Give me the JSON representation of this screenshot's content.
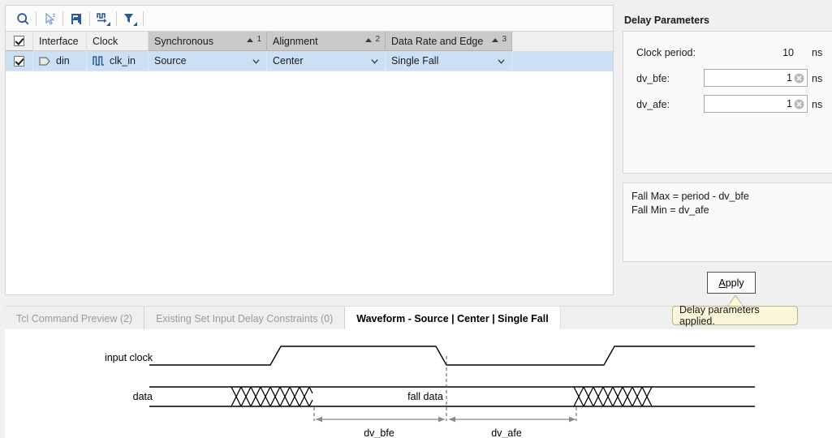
{
  "toolbar": {
    "buttons": [
      {
        "name": "search-icon",
        "label": "Search"
      },
      {
        "name": "select-cursor-icon",
        "label": "Select"
      },
      {
        "name": "auto-detect-icon",
        "label": "Auto Detect"
      },
      {
        "name": "waveform-icon",
        "label": "Waveform Options"
      },
      {
        "name": "filter-icon",
        "label": "Filter"
      }
    ]
  },
  "table": {
    "columns": [
      {
        "label": "",
        "type": "checkbox"
      },
      {
        "label": "Interface",
        "sort": ""
      },
      {
        "label": "Clock",
        "sort": ""
      },
      {
        "label": "Synchronous",
        "sort": "1"
      },
      {
        "label": "Alignment",
        "sort": "2"
      },
      {
        "label": "Data Rate and Edge",
        "sort": "3"
      }
    ],
    "rows": [
      {
        "checked": true,
        "interface": "din",
        "clock": "clk_in",
        "synchronous": "Source",
        "alignment": "Center",
        "data_rate_and_edge": "Single Fall"
      }
    ]
  },
  "delay_panel": {
    "title": "Delay Parameters",
    "clock_period_label": "Clock period:",
    "clock_period_value": "10",
    "clock_period_unit": "ns",
    "dv_bfe_label": "dv_bfe:",
    "dv_bfe_value": "1",
    "dv_bfe_unit": "ns",
    "dv_afe_label": "dv_afe:",
    "dv_afe_value": "1",
    "dv_afe_unit": "ns",
    "formula_line1": "Fall Max = period - dv_bfe",
    "formula_line2": "Fall Min = dv_afe",
    "apply_label_pre": "",
    "apply_label_underlined": "A",
    "apply_label_post": "pply",
    "tooltip_text": "Delay parameters applied."
  },
  "tabs": [
    {
      "label": "Tcl Command Preview (2)",
      "active": false
    },
    {
      "label": "Existing Set Input Delay Constraints (0)",
      "active": false
    },
    {
      "label": "Waveform - Source | Center | Single Fall",
      "active": true
    }
  ],
  "waveform": {
    "clock_label": "input clock",
    "data_label": "data",
    "fall_data_label": "fall data",
    "dv_bfe_label": "dv_bfe",
    "dv_afe_label": "dv_afe"
  },
  "colors": {
    "icon_blue": "#2b5797",
    "header_gray": "#cacaca",
    "selection_blue": "#cce0f5",
    "tooltip_yellow": "#fbf7d8",
    "waveform_line": "#000000",
    "dimension_gray": "#888888"
  }
}
